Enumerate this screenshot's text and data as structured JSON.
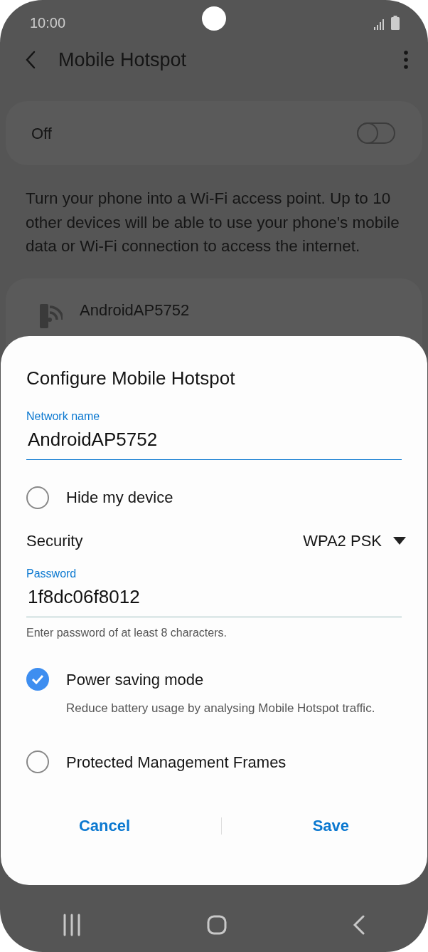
{
  "status_bar": {
    "time": "10:00"
  },
  "header": {
    "title": "Mobile Hotspot"
  },
  "main_switch": {
    "label": "Off",
    "on": false
  },
  "description": "Turn your phone into a Wi-Fi access point. Up to 10 other devices will be able to use your phone's mobile data or Wi-Fi connection to access the internet.",
  "network_item": {
    "name": "AndroidAP5752"
  },
  "dialog": {
    "title": "Configure Mobile Hotspot",
    "network_name": {
      "label": "Network name",
      "value": "AndroidAP5752",
      "focused": true
    },
    "hide_device": {
      "label": "Hide my device",
      "checked": false
    },
    "security": {
      "label": "Security",
      "value": "WPA2 PSK"
    },
    "password": {
      "label": "Password",
      "value": "1f8dc06f8012",
      "focused": false,
      "hint": "Enter password of at least 8 characters."
    },
    "options": [
      {
        "label": "Power saving mode",
        "description": "Reduce battery usage by analysing Mobile Hotspot traffic.",
        "checked": true
      },
      {
        "label": "Protected Management Frames",
        "checked": false
      }
    ],
    "buttons": [
      {
        "label": "Cancel"
      },
      {
        "label": "Save"
      }
    ]
  }
}
